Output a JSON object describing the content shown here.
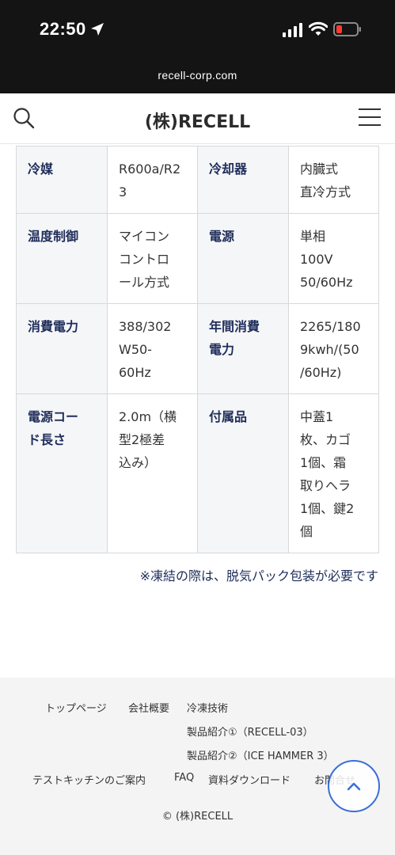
{
  "status_bar": {
    "time": "22:50"
  },
  "browser": {
    "url": "recell-corp.com"
  },
  "header": {
    "brand": "(株)RECELL"
  },
  "spec_rows": [
    [
      {
        "type": "label",
        "text": "冷媒"
      },
      {
        "type": "value",
        "text": "R600a/R2\n3"
      },
      {
        "type": "label",
        "text": "冷却器"
      },
      {
        "type": "value",
        "text": "内臓式\n直冷方式"
      }
    ],
    [
      {
        "type": "label",
        "text": "温度制御"
      },
      {
        "type": "value",
        "text": "マイコン\nコントロ\nール方式"
      },
      {
        "type": "label",
        "text": "電源"
      },
      {
        "type": "value",
        "text": "単相\n100V\n50/60Hz"
      }
    ],
    [
      {
        "type": "label",
        "text": "消費電力"
      },
      {
        "type": "value",
        "text": "388/302\nW50-\n60Hz"
      },
      {
        "type": "label",
        "text": "年間消費\n電力"
      },
      {
        "type": "value",
        "text": "2265/180\n9kwh/(50\n/60Hz)"
      }
    ],
    [
      {
        "type": "label",
        "text": "電源コー\nド長さ"
      },
      {
        "type": "value",
        "text": "2.0m（横\n型2極差\n込み）"
      },
      {
        "type": "label",
        "text": "付属品"
      },
      {
        "type": "value",
        "text": "中蓋1\n枚、カゴ\n1個、霜\n取りヘラ\n1個、鍵2\n個"
      }
    ]
  ],
  "note": "※凍結の際は、脱気パック包装が必要です",
  "footer": {
    "links": {
      "top": "トップページ",
      "company": "会社概要",
      "tech": "冷凍技術",
      "product1": "製品紹介①（RECELL-03）",
      "product2": "製品紹介②（ICE HAMMER 3）",
      "kitchen": "テストキッチンのご案内",
      "faq": "FAQ",
      "download": "資料ダウンロード",
      "contact": "お問合せ"
    },
    "copyright": "© (株)RECELL"
  }
}
